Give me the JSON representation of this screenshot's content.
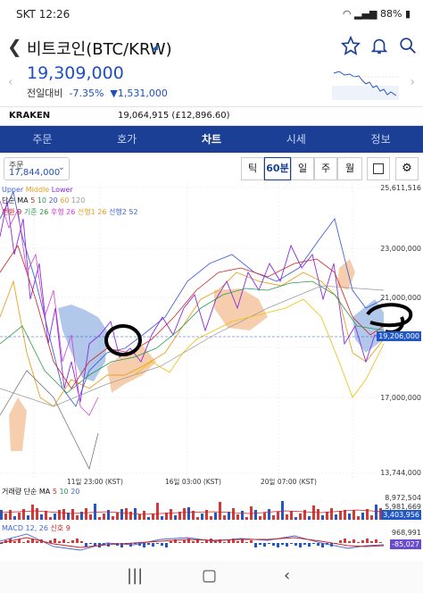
{
  "status": {
    "carrier_time": "SKT 12:26",
    "battery": "88%"
  },
  "header": {
    "title": "비트코인(BTC/KRW)"
  },
  "price": {
    "current": "19,309,000",
    "change_label": "전일대비",
    "change_pct": "-7.35%",
    "change_amt": "1,531,000"
  },
  "exchange": {
    "name": "KRAKEN",
    "value": "19,064,915 (£12,896.60)"
  },
  "tabs": [
    "주문",
    "호가",
    "차트",
    "시세",
    "정보"
  ],
  "active_tab": "차트",
  "controls": {
    "order_label": "주문",
    "order_value": "17,844,000",
    "periods": [
      "틱",
      "60분",
      "일",
      "주",
      "월"
    ],
    "active_period": "60분"
  },
  "legend": {
    "bollinger": [
      "Upper",
      "Middle",
      "Lower"
    ],
    "ma_label": "단순 MA",
    "ma_periods": [
      "5",
      "10",
      "20",
      "60",
      "120"
    ],
    "ichimoku": [
      "전환 9",
      "기준 26",
      "후행 26",
      "선행1 26",
      "선행2 52"
    ],
    "volume": [
      "거래량 단순 MA",
      "5",
      "10",
      "20"
    ],
    "macd": [
      "MACD 12, 26",
      "신호 9"
    ]
  },
  "y_axis": [
    "25,611,516",
    "23,000,000",
    "21,000,000",
    "19,206,000",
    "17,000,000",
    "13,744,000"
  ],
  "current_tag": "19,206,000",
  "x_axis": [
    "11일 23:00 (KST)",
    "16일 03:00 (KST)",
    "20일 07:00 (KST)"
  ],
  "volume_axis": [
    "8,972,504",
    "5,981,669",
    "3,403,956"
  ],
  "macd_axis": [
    "968,991",
    "-85,027"
  ],
  "colors": {
    "navy": "#1b3f94",
    "blue": "#1f4fbf",
    "accent": "#2258c5"
  }
}
